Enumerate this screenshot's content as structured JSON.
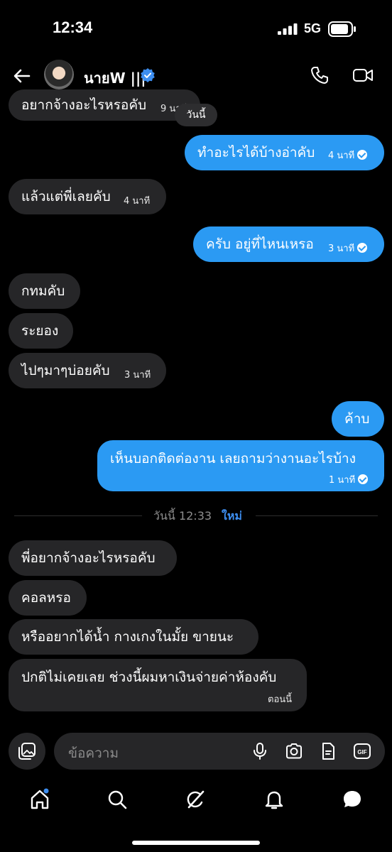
{
  "status_bar": {
    "time": "12:34",
    "network": "5G"
  },
  "header": {
    "name": "นายW |||"
  },
  "date_chip": "วันนี้",
  "messages": [
    {
      "text": "อยากจ้างอะไรหรอคับ",
      "meta": "9 นาที"
    },
    {
      "text": "ทำอะไรได้บ้างอ่าคับ",
      "meta": "4 นาที"
    },
    {
      "text": "แล้วแต่พี่เลยคับ",
      "meta": "4 นาที"
    },
    {
      "text": "ครับ อยู่ที่ไหนเหรอ",
      "meta": "3 นาที"
    },
    {
      "text": "กทมคับ"
    },
    {
      "text": "ระยอง"
    },
    {
      "text": "ไปๆมาๆบ่อยคับ",
      "meta": "3 นาที"
    },
    {
      "text": "ค้าบ"
    },
    {
      "text": "เห็นบอกติดต่องาน เลยถามว่างานอะไรบ้าง",
      "meta": "1 นาที"
    },
    {
      "text": "พี่อยากจ้างอะไรหรอคับ"
    },
    {
      "text": "คอลหรอ"
    },
    {
      "text": "หรืออยากได้น้ำ กางเกงในมั้ย ขายนะ"
    },
    {
      "text": "ปกติไม่เคยเลย ช่วงนี้ผมหาเงินจ่ายค่าห้องคับ",
      "meta": "ตอนนี้"
    }
  ],
  "divider": {
    "time": "วันนี้ 12:33",
    "new_label": "ใหม่"
  },
  "composer": {
    "placeholder": "ข้อความ"
  },
  "colors": {
    "outgoing": "#2b9af3",
    "incoming": "#262628",
    "background": "#000000",
    "accent": "#3d8ef0"
  }
}
